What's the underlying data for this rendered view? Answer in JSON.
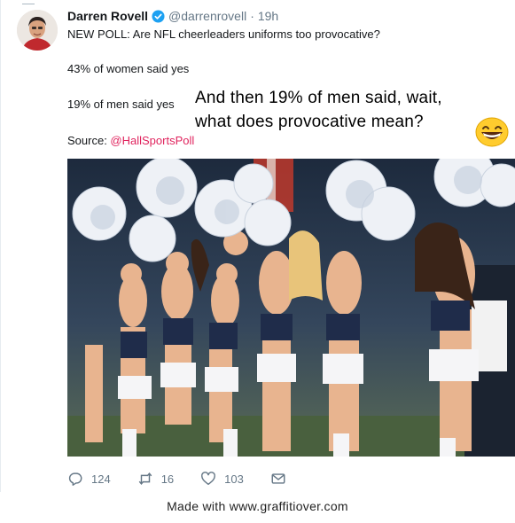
{
  "tweet": {
    "author_name": "Darren Rovell",
    "handle": "@darrenrovell",
    "separator": "·",
    "time": "19h",
    "lines": [
      "NEW POLL: Are NFL cheerleaders uniforms too provocative?",
      "43% of women said yes",
      "19% of men said yes"
    ],
    "source_prefix": "Source: ",
    "source_link": "@HallSportsPoll"
  },
  "overlay": {
    "line1": "And then 19% of men said, wait,",
    "line2": "what does provocative mean?"
  },
  "actions": {
    "reply_count": "124",
    "retweet_count": "16",
    "like_count": "103"
  },
  "footer": {
    "text": "Made with www.graffitiover.com"
  },
  "colors": {
    "link": "#e0245e",
    "verified": "#1da1f2",
    "icon_gray": "#657786"
  }
}
